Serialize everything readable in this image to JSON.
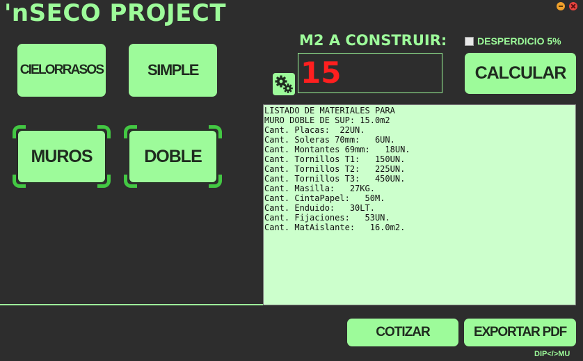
{
  "app": {
    "title": "'nSECO PROJECT",
    "credit": "DIP</>MU"
  },
  "buttons": {
    "cielorrasos": "CIELORRASOS",
    "simple": "SIMPLE",
    "muros": "MUROS",
    "doble": "DOBLE",
    "calcular": "CALCULAR",
    "cotizar": "COTIZAR",
    "exportar_pdf": "EXPORTAR PDF"
  },
  "selection": {
    "category": "MUROS",
    "type": "DOBLE"
  },
  "m2": {
    "label": "M2 A CONSTRUIR:",
    "value": "15"
  },
  "desperdicio": {
    "label": "DESPERDICIO 5%",
    "checked": false
  },
  "materials": {
    "lines": [
      "LISTADO DE MATERIALES PARA",
      "MURO DOBLE DE SUP: 15.0m2",
      "Cant. Placas:  22UN.",
      "Cant. Soleras 70mm:   6UN.",
      "Cant. Montantes 69mm:   18UN.",
      "Cant. Tornillos T1:   150UN.",
      "Cant. Tornillos T2:   225UN.",
      "Cant. Tornillos T3:   450UN.",
      "Cant. Masilla:   27KG.",
      "Cant. CintaPapel:   50M.",
      "Cant. Enduido:   30LT.",
      "Cant. Fijaciones:   53UN.",
      "Cant. MatAislante:   16.0m2."
    ]
  },
  "icons": {
    "gear": "gears-icon",
    "minimize": "minimize-icon",
    "close": "close-icon",
    "checkbox": "checkbox-icon"
  },
  "colors": {
    "background": "#2d2d2d",
    "accent": "#9dfb9a",
    "selected_frame": "#43c843",
    "value": "#ff1f1f",
    "textarea": "#ccffcc"
  }
}
